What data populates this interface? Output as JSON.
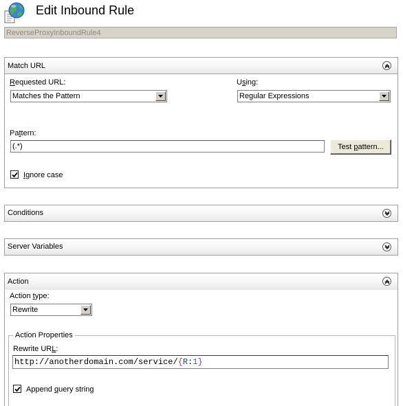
{
  "header": {
    "title": "Edit Inbound Rule",
    "rule_name": "ReverseProxyInboundRule4",
    "icon": "globe-document-icon"
  },
  "match_url": {
    "section_title": "Match URL",
    "requested_url_label_pre": "",
    "requested_url_label_ul": "R",
    "requested_url_label_post": "equested URL:",
    "requested_url_value": "Matches the Pattern",
    "using_label_pre": "U",
    "using_label_ul": "s",
    "using_label_post": "ing:",
    "using_value": "Regular Expressions",
    "pattern_label_pre": "Pa",
    "pattern_label_ul": "t",
    "pattern_label_post": "tern:",
    "pattern_value": "(.*)",
    "test_button_pre": "Test ",
    "test_button_ul": "p",
    "test_button_post": "attern...",
    "ignore_case_ul": "I",
    "ignore_case_post": "gnore case",
    "ignore_case_checked": true,
    "collapse_icon": "chevron-up-icon"
  },
  "conditions": {
    "section_title": "Conditions",
    "expand_icon": "chevron-down-icon"
  },
  "server_variables": {
    "section_title": "Server Variables",
    "expand_icon": "chevron-down-icon"
  },
  "action": {
    "section_title": "Action",
    "action_type_label_pre": "Action ",
    "action_type_label_ul": "t",
    "action_type_label_post": "ype:",
    "action_type_value": "Rewrite",
    "properties_legend": "Action Properties",
    "rewrite_url_label_pre": "Rewrite UR",
    "rewrite_url_label_ul": "L",
    "rewrite_url_label_post": ":",
    "rewrite_url_part1": "http://anotherdomain.com/service/",
    "rewrite_url_brace_open": "{",
    "rewrite_url_var": "R",
    "rewrite_url_colon": ":",
    "rewrite_url_num": "1",
    "rewrite_url_brace_close": "}",
    "append_qs_pre": "Append ",
    "append_qs_ul": "q",
    "append_qs_post": "uery string",
    "append_qs_checked": true,
    "collapse_icon": "chevron-up-icon"
  }
}
